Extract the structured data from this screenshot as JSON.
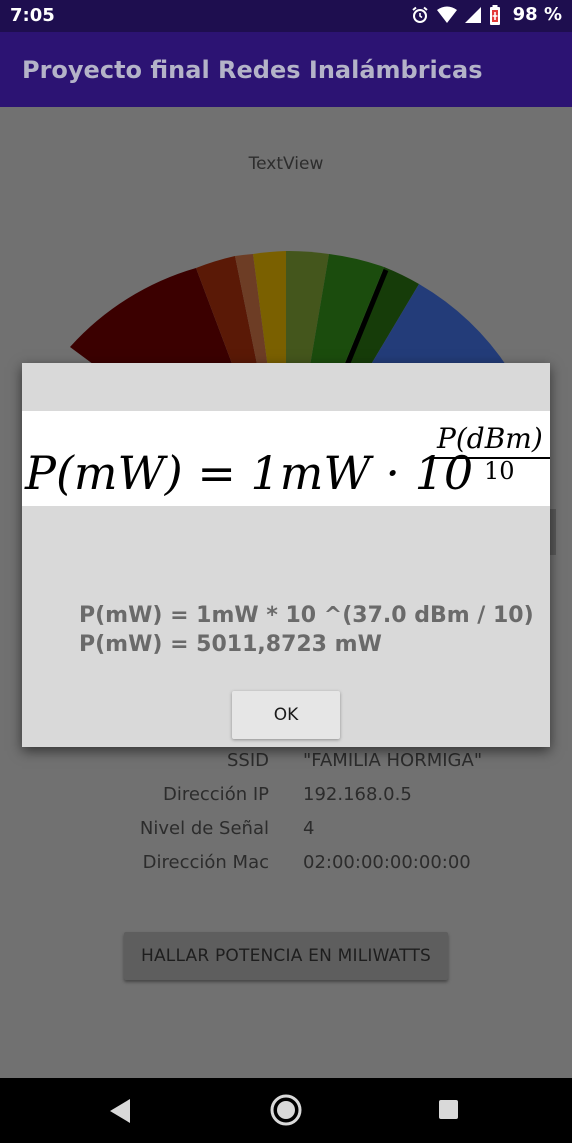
{
  "status_bar": {
    "time": "7:05",
    "battery_percent": "98 %",
    "icons": [
      "alarm-icon",
      "wifi-icon",
      "signal-icon",
      "battery-icon"
    ]
  },
  "app_bar": {
    "title": "Proyecto final Redes Inalámbricas"
  },
  "main": {
    "textview": "TextView",
    "gauge": {
      "segment_colors": [
        "#3b0000",
        "#5a1906",
        "#6d3d25",
        "#7a6000",
        "#44561c",
        "#1b4c0d",
        "#163c09",
        "#233c79"
      ],
      "needle_color": "#000000"
    },
    "info": [
      {
        "label": "SSID",
        "value": "\"FAMILIA HORMIGA\""
      },
      {
        "label": "Dirección IP",
        "value": "192.168.0.5"
      },
      {
        "label": "Nivel de Señal",
        "value": "4"
      },
      {
        "label": "Dirección Mac",
        "value": "02:00:00:00:00:00"
      }
    ],
    "button_label": "HALLAR POTENCIA EN MILIWATTS"
  },
  "dialog": {
    "formula_lhs": "P(mW) = 1mW · 10",
    "formula_numerator": "P(dBm)",
    "formula_denominator": "10",
    "line1": "P(mW) = 1mW * 10 ^(37.0 dBm / 10)",
    "line2": "P(mW) = 5011,8723 mW",
    "ok_label": "OK"
  },
  "nav_bar": {
    "icons": [
      "back-icon",
      "home-icon",
      "recents-icon"
    ]
  }
}
